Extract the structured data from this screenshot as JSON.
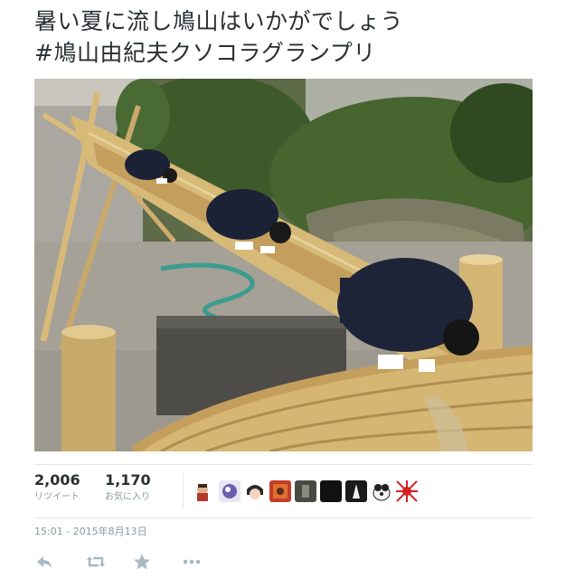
{
  "tweet": {
    "text_line1": "暑い夏に流し鳩山はいかがでしょう",
    "text_line2": "#鳩山由紀夫クソコラグランプリ"
  },
  "stats": {
    "retweets_count": "2,006",
    "retweets_label": "リツイート",
    "favorites_count": "1,170",
    "favorites_label": "お気に入り"
  },
  "favoriters": [
    {
      "icon": "avatar-doll"
    },
    {
      "icon": "avatar-purple-character"
    },
    {
      "icon": "avatar-anime-face"
    },
    {
      "icon": "avatar-red-art"
    },
    {
      "icon": "avatar-dark-photo"
    },
    {
      "icon": "avatar-black"
    },
    {
      "icon": "avatar-black-white"
    },
    {
      "icon": "avatar-dog"
    },
    {
      "icon": "avatar-rising-sun"
    }
  ],
  "timestamp": "15:01 - 2015年8月13日",
  "actions": [
    {
      "icon": "reply-icon"
    },
    {
      "icon": "retweet-icon"
    },
    {
      "icon": "favorite-star-icon"
    },
    {
      "icon": "more-icon"
    }
  ],
  "colors": {
    "text": "#292f33",
    "muted": "#8899a6",
    "divider": "#e1e8ed"
  }
}
